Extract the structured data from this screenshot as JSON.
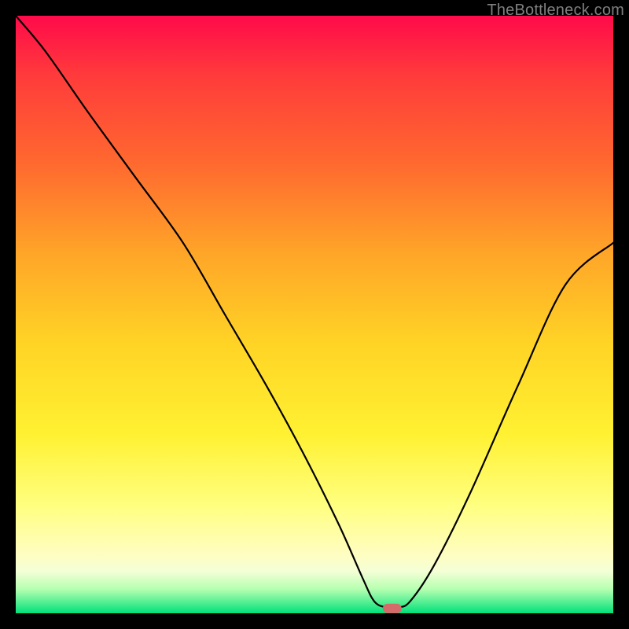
{
  "watermark": "TheBottleneck.com",
  "chart_data": {
    "type": "line",
    "title": "",
    "xlabel": "",
    "ylabel": "",
    "xlim": [
      0,
      100
    ],
    "ylim": [
      0,
      100
    ],
    "gradient_background": {
      "top": "#ff0a4a",
      "middle": "#ffd425",
      "bottom": "#00e07a"
    },
    "series": [
      {
        "name": "bottleneck-curve",
        "x": [
          0,
          5,
          12,
          20,
          28,
          35,
          42,
          48,
          54,
          58,
          60,
          62,
          64,
          66,
          70,
          76,
          84,
          92,
          100
        ],
        "y": [
          100,
          94,
          84,
          73,
          62,
          50,
          38,
          27,
          15,
          6,
          2,
          1,
          1,
          2,
          8,
          20,
          38,
          55,
          62
        ]
      }
    ],
    "marker": {
      "name": "optimum-point",
      "x": 63,
      "y": 0.8,
      "color": "#d46a6a"
    }
  }
}
